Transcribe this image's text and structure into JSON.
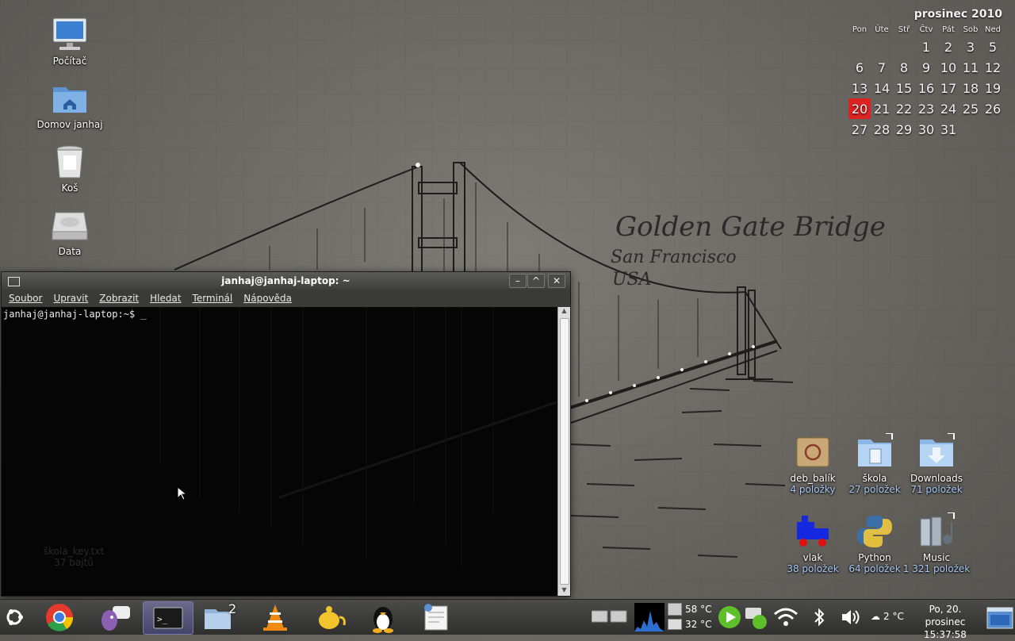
{
  "desktop": {
    "left_icons": [
      {
        "label": "Počítač",
        "icon": "computer-icon"
      },
      {
        "label": "Domov janhaj",
        "icon": "home-folder-icon"
      },
      {
        "label": "Koš",
        "icon": "trash-icon"
      },
      {
        "label": "Data",
        "icon": "drive-icon"
      }
    ],
    "right_icons": [
      {
        "label": "deb_balík",
        "sub": "4 položky",
        "icon": "package-icon"
      },
      {
        "label": "škola",
        "sub": "27 položek",
        "icon": "folder-link-icon"
      },
      {
        "label": "Downloads",
        "sub": "71 položek",
        "icon": "downloads-folder-icon"
      },
      {
        "label": "vlak",
        "sub": "38 položek",
        "icon": "train-icon"
      },
      {
        "label": "Python",
        "sub": "64 položek",
        "icon": "python-icon"
      },
      {
        "label": "Music",
        "sub": "1 321 položek",
        "icon": "music-folder-icon"
      }
    ],
    "ghost_file": {
      "label": "škola_key.txt",
      "sub": "37 bajtů"
    }
  },
  "wallpaper": {
    "title": "Golden Gate Bridge",
    "line2": "San Francisco",
    "line3": "USA"
  },
  "calendar": {
    "month": "prosinec 2010",
    "weekdays": [
      "Pon",
      "Úte",
      "Stř",
      "Čtv",
      "Pát",
      "Sob",
      "Ned"
    ],
    "weeks": [
      [
        "",
        "",
        "",
        "1",
        "2",
        "3",
        "5"
      ],
      [
        "6",
        "7",
        "8",
        "9",
        "10",
        "11",
        "12"
      ],
      [
        "13",
        "14",
        "15",
        "16",
        "17",
        "18",
        "19"
      ],
      [
        "20",
        "21",
        "22",
        "23",
        "24",
        "25",
        "26"
      ],
      [
        "27",
        "28",
        "29",
        "30",
        "31",
        "",
        ""
      ]
    ],
    "today": "20"
  },
  "terminal": {
    "title": "janhaj@janhaj-laptop: ~",
    "menu": [
      "Soubor",
      "Upravit",
      "Zobrazit",
      "Hledat",
      "Terminál",
      "Nápověda"
    ],
    "prompt": "janhaj@janhaj-laptop:~$ _"
  },
  "panel": {
    "tasks": [
      {
        "name": "chrome",
        "icon": "chrome-icon"
      },
      {
        "name": "pidgin",
        "icon": "chat-icon"
      },
      {
        "name": "terminal",
        "icon": "terminal-icon"
      },
      {
        "name": "files",
        "icon": "folder-icon",
        "badge": "2"
      },
      {
        "name": "vlc",
        "icon": "vlc-icon"
      },
      {
        "name": "teapot",
        "icon": "teapot-icon"
      },
      {
        "name": "tux",
        "icon": "tux-icon"
      },
      {
        "name": "editor",
        "icon": "text-editor-icon"
      }
    ],
    "temp_cpu": "58 °C",
    "temp_hdd": "32 °C",
    "weather": "2 °C",
    "clock_date": "Po, 20. prosinec",
    "clock_time": "15:37:58"
  },
  "colors": {
    "today_bg": "#dd2222",
    "panel_bg": "#3a3a38",
    "link_blue": "#a9c8f5"
  }
}
